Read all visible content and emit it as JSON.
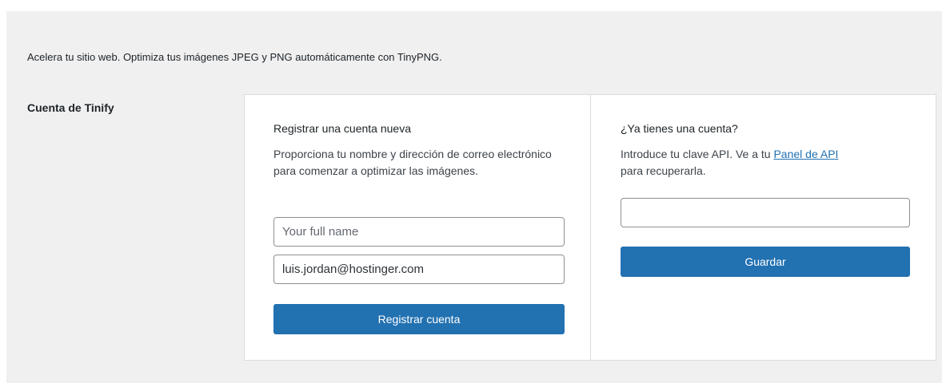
{
  "intro_text": "Acelera tu sitio web. Optimiza tus imágenes JPEG y PNG automáticamente con TinyPNG.",
  "account_label": "Cuenta de Tinify",
  "register": {
    "heading": "Registrar una cuenta nueva",
    "description": "Proporciona tu nombre y dirección de correo electrónico para comenzar a optimizar las imágenes.",
    "name_placeholder": "Your full name",
    "name_value": "",
    "email_value": "luis.jordan@hostinger.com",
    "button_label": "Registrar cuenta"
  },
  "existing": {
    "heading": "¿Ya tienes una cuenta?",
    "description_before": "Introduce tu clave API. Ve a tu ",
    "link_label": "Panel de API",
    "description_after": "para recuperarla.",
    "api_key_value": "",
    "button_label": "Guardar"
  },
  "colors": {
    "background": "#f0f0f1",
    "primary_button": "#2271b1",
    "link": "#2271b1"
  }
}
